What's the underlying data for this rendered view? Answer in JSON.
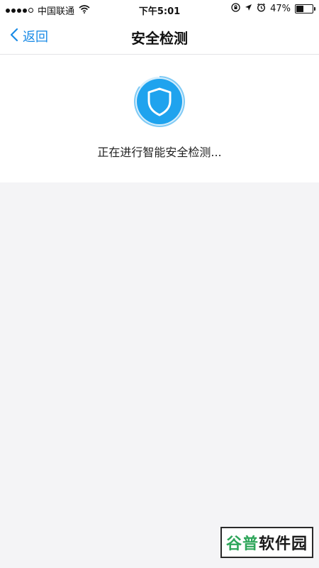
{
  "status_bar": {
    "carrier": "中国联通",
    "time": "下午5:01",
    "battery_percent_text": "47%",
    "battery_level": 0.47
  },
  "nav": {
    "back_label": "返回",
    "title": "安全检测"
  },
  "detection": {
    "status_text": "正在进行智能安全检测..."
  },
  "watermark": {
    "accent": "谷普",
    "rest": "软件园"
  },
  "colors": {
    "accent_blue": "#1a8be6",
    "shield_blue": "#1fa3ee",
    "page_bg": "#f4f4f6"
  }
}
